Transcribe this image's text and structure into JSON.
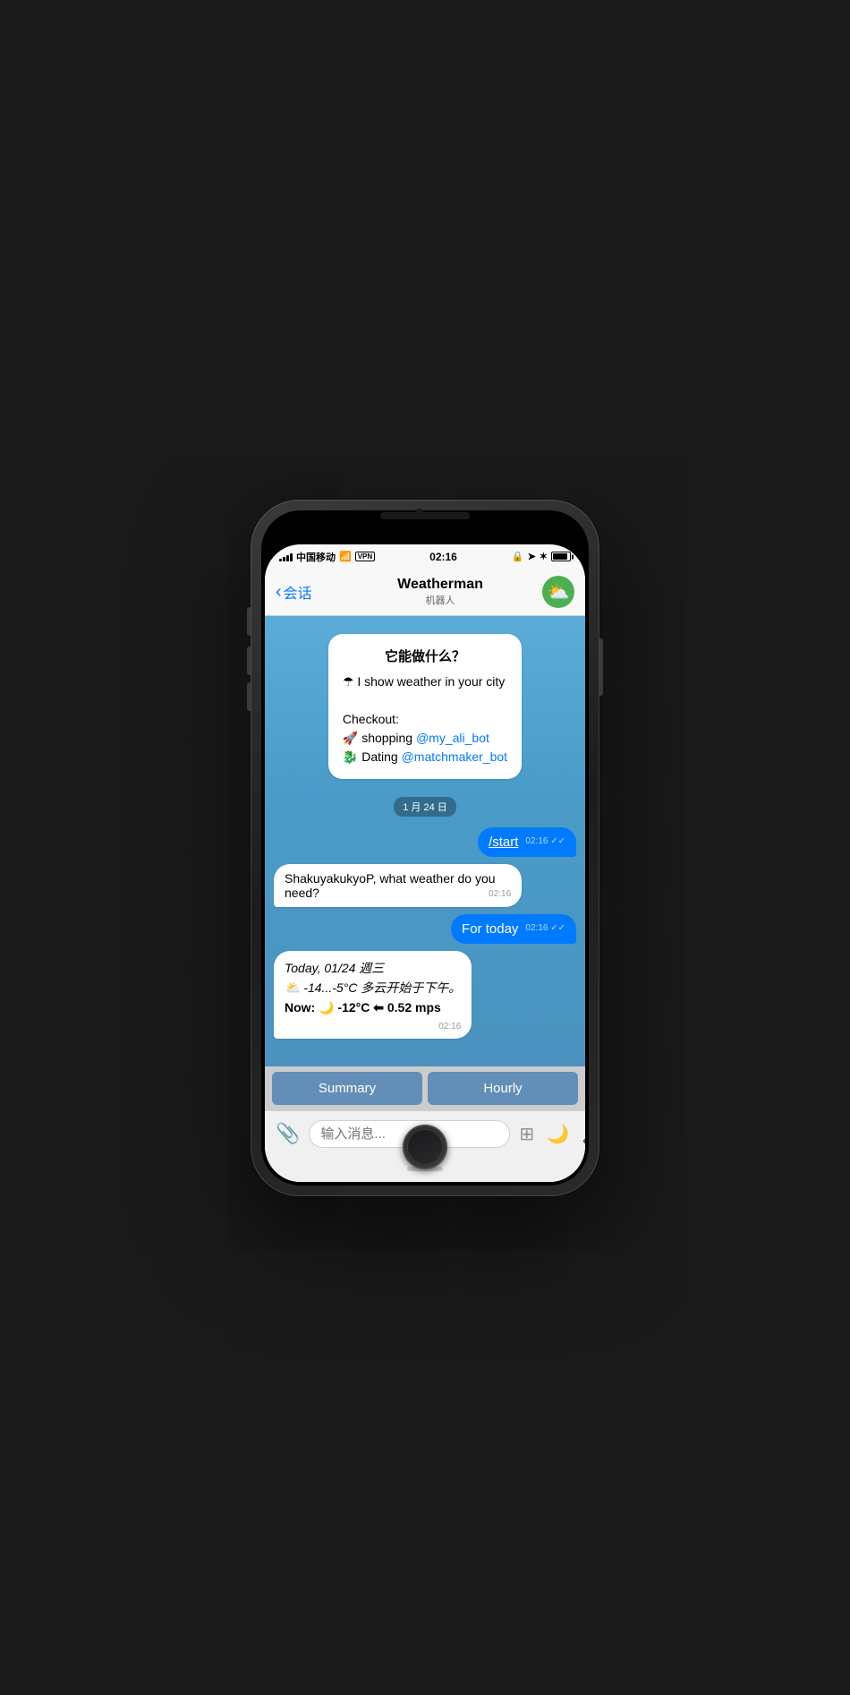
{
  "phone": {
    "status_bar": {
      "carrier": "中国移动",
      "wifi": "WiFi",
      "vpn": "VPN",
      "time": "02:16",
      "lock_icon": "🔒",
      "location_icon": "↗",
      "bluetooth_icon": "✶"
    },
    "nav": {
      "back_label": "会话",
      "title": "Weatherman",
      "subtitle": "机器人"
    },
    "chat": {
      "welcome": {
        "title": "它能做什么？",
        "line1": "☂ I show weather in your city",
        "checkout": "Checkout:",
        "shopping": "🚀 shopping",
        "shopping_link": "@my_ali_bot",
        "dating": "🐉 Dating",
        "dating_link": "@matchmaker_bot"
      },
      "date_sep": "1 月 24 日",
      "msg_start": "/start",
      "msg_start_time": "02:16",
      "msg_bot1": "ShakuyakukyoP, what weather do you need?",
      "msg_bot1_time": "02:16",
      "msg_for_today": "For today",
      "msg_for_today_time": "02:16",
      "msg_weather": "Today, 01/24 週三",
      "msg_weather_line2": "⛅ -14...-5°C 多云开始于下午。",
      "msg_weather_line3": "Now: 🌙 -12°C ⬅ 0.52 mps",
      "msg_weather_time": "02:16",
      "btn_summary": "Summary",
      "btn_hourly": "Hourly"
    },
    "input_bar": {
      "placeholder": "输入消息..."
    }
  }
}
